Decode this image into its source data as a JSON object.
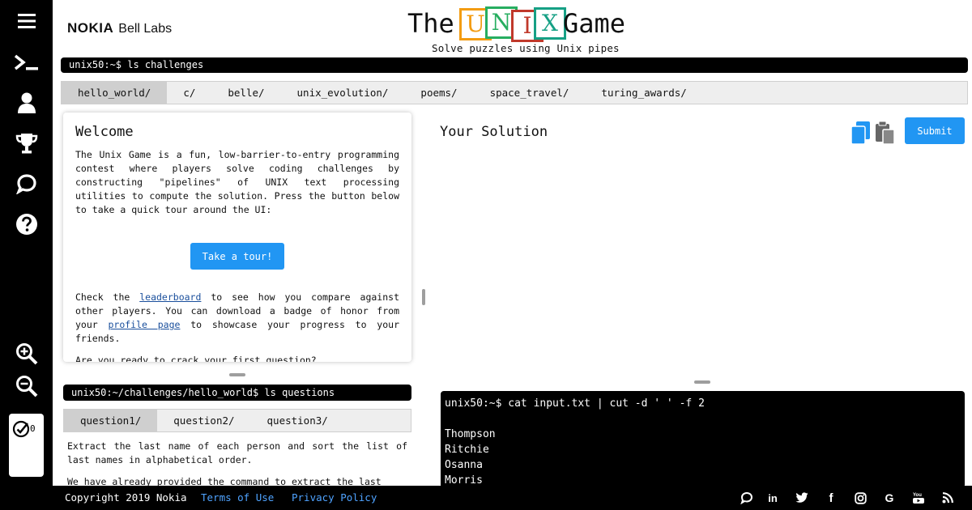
{
  "header": {
    "brand_nokia": "NOKIA",
    "brand_bell": "Bell Labs",
    "logo_the": "The",
    "logo_blocks": [
      "U",
      "N",
      "I",
      "X"
    ],
    "logo_game": "Game",
    "tagline": "Solve puzzles using Unix pipes"
  },
  "sidebar": {
    "icons": [
      "menu-icon",
      "terminal-icon",
      "user-icon",
      "trophy-icon",
      "chat-icon",
      "help-icon",
      "zoom-in-icon",
      "zoom-out-icon"
    ],
    "solved_count": "0"
  },
  "challenges": {
    "prompt": "unix50:~$ ls challenges",
    "tabs": [
      "hello_world/",
      "c/",
      "belle/",
      "unix_evolution/",
      "poems/",
      "space_travel/",
      "turing_awards/"
    ],
    "active": "hello_world/"
  },
  "welcome": {
    "title": "Welcome",
    "intro": "The Unix Game is a fun, low-barrier-to-entry programming contest where players solve coding challenges by constructing \"pipelines\" of UNIX text processing utilities to compute the solution. Press the button below to take a quick tour around the UI:",
    "tour_button": "Take a tour!",
    "p2_before": "Check the ",
    "leaderboard_link": "leaderboard",
    "p2_middle": " to see how you compare against other players. You can download a badge of honor from your ",
    "profile_link": "profile page",
    "p2_after": " to showcase your progress to your friends.",
    "p3": "Are you ready to crack your first question?"
  },
  "questions": {
    "prompt": "unix50:~/challenges/hello_world$ ls questions",
    "tabs": [
      "question1/",
      "question2/",
      "question3/"
    ],
    "active": "question1/",
    "text_1": "Extract the last name of each person and sort the list of last names in alphabetical order.",
    "text_2": "We have already provided the command to extract the last"
  },
  "solution": {
    "title": "Your Solution",
    "submit_label": "Submit"
  },
  "output": {
    "lines": [
      "unix50:~$ cat input.txt | cut -d ' ' -f 2",
      "",
      "Thompson",
      "Ritchie",
      "Osanna",
      "Morris"
    ]
  },
  "footer": {
    "copyright": "Copyright 2019 Nokia",
    "terms": "Terms of Use",
    "privacy": "Privacy Policy",
    "social": [
      "chat-icon",
      "linkedin-icon",
      "twitter-icon",
      "facebook-icon",
      "instagram-icon",
      "google-icon",
      "youtube-icon",
      "rss-icon"
    ]
  },
  "colors": {
    "accent": "#2196f3",
    "link": "#1a4f9c",
    "footer_link": "#4fa3ff",
    "block_colors": [
      "#f39c12",
      "#27ae60",
      "#c0392b",
      "#16a085"
    ]
  }
}
